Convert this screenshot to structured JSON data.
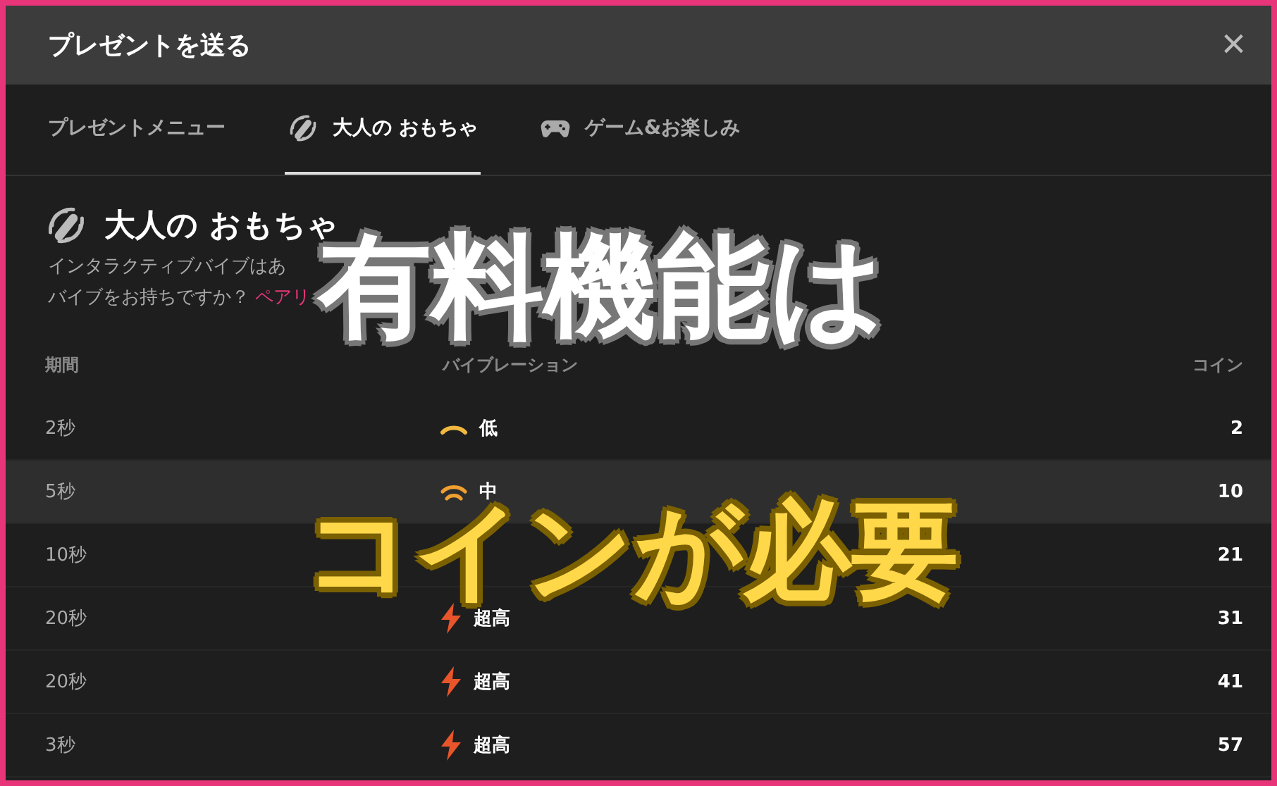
{
  "window": {
    "title": "プレゼントを送る",
    "close": "×"
  },
  "tabs": [
    {
      "label": "プレゼントメニュー",
      "selected": false
    },
    {
      "label": "大人の おもちゃ",
      "selected": true
    },
    {
      "label": "ゲーム&お楽しみ",
      "selected": false
    }
  ],
  "section": {
    "title": "大人の おもちゃ",
    "description_line_1": "インタラクティブバイブはあ",
    "description_line_2": "バイブをお持ちですか？",
    "link": "ペアリ"
  },
  "table": {
    "columns": [
      "期間",
      "バイブレーション",
      "コイン"
    ],
    "rows": [
      {
        "duration": "2秒",
        "kind": "low",
        "level_label": "低",
        "coins": "2",
        "selected": false
      },
      {
        "duration": "5秒",
        "kind": "mid",
        "level_label": "中",
        "coins": "10",
        "selected": true
      },
      {
        "duration": "10秒",
        "kind": "hidden",
        "coins": "21",
        "selected": false
      },
      {
        "duration": "20秒",
        "kind": "ultra",
        "level_label": "超高",
        "coins": "31",
        "selected": false
      },
      {
        "duration": "20秒",
        "kind": "ultra",
        "level_label": "超高",
        "coins": "41",
        "selected": false
      },
      {
        "duration": "3秒",
        "kind": "ultra",
        "level_label": "超高",
        "coins": "57",
        "selected": false
      }
    ]
  },
  "captions": [
    {
      "text": "有料機能は",
      "kind": "white"
    },
    {
      "text": "コインが必要",
      "kind": "yellow"
    }
  ]
}
